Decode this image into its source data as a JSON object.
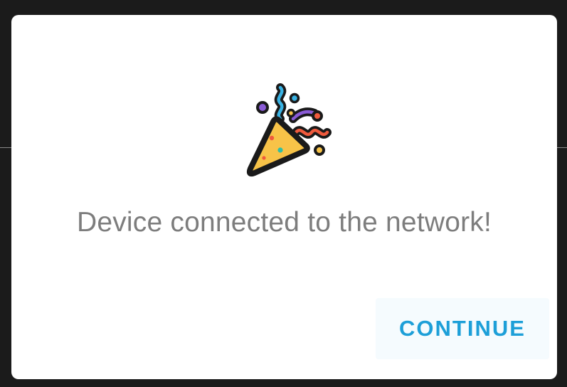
{
  "dialog": {
    "icon": "party-popper-icon",
    "message": "Device connected to the network!",
    "continue_label": "CONTINUE"
  },
  "colors": {
    "accent": "#1d9fd8",
    "message_text": "#7d7d7d",
    "dialog_bg": "#ffffff",
    "backdrop": "#1b1b1b",
    "popper_cone": "#f7c348",
    "confetti_blue": "#39b2e3",
    "confetti_red": "#ef5a3d",
    "confetti_purple": "#8a5bd6",
    "confetti_yellow": "#f7c348",
    "confetti_teal": "#2fbfa5"
  }
}
